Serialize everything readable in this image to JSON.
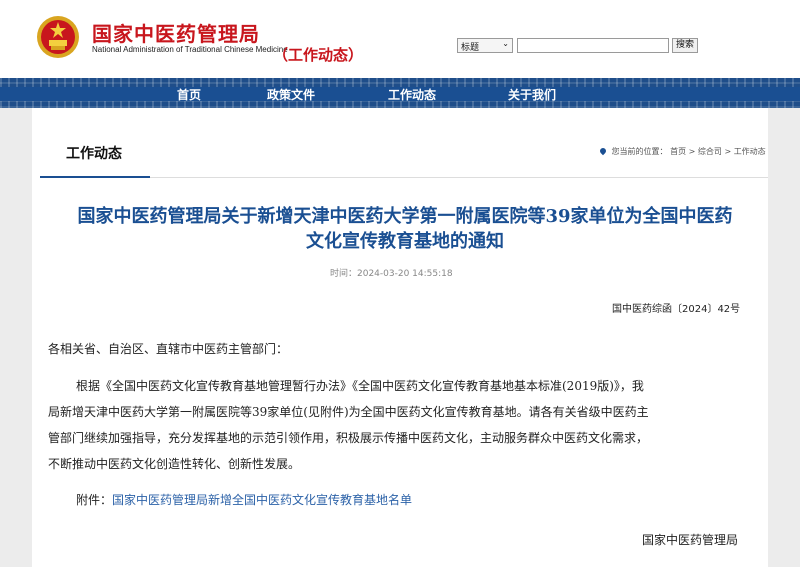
{
  "header": {
    "site_title_cn": "国家中医药管理局",
    "site_title_en": "National Administration of Traditional Chinese Medicine",
    "section_tag": "（工作动态）",
    "search": {
      "select_value": "标题",
      "button_label": "搜索",
      "input_value": ""
    }
  },
  "nav": {
    "items": [
      "首页",
      "政策文件",
      "工作动态",
      "关于我们"
    ]
  },
  "section": {
    "title": "工作动态"
  },
  "breadcrumb": {
    "prefix": "您当前的位置：",
    "items": [
      "首页",
      "综合司",
      "工作动态"
    ]
  },
  "article": {
    "title_line1": "国家中医药管理局关于新增天津中医药大学第一附属医院等39家单位为全国中医药",
    "title_line2": "文化宣传教育基地的通知",
    "time": "时间：2024-03-20 14:55:18",
    "doc_number": "国中医药综函〔2024〕42号",
    "salutation": "各相关省、自治区、直辖市中医药主管部门：",
    "body_lines": [
      "根据《全国中医药文化宣传教育基地管理暂行办法》《全国中医药文化宣传教育基地基本标准(2019版)》，我",
      "局新增天津中医药大学第一附属医院等39家单位(见附件)为全国中医药文化宣传教育基地。请各有关省级中医药主",
      "管部门继续加强指导，充分发挥基地的示范引领作用，积极展示传播中医药文化，主动服务群众中医药文化需求，",
      "不断推动中医药文化创造性转化、创新性发展。"
    ],
    "attachment_label": "附件：",
    "attachment_link": "国家中医药管理局新增全国中医药文化宣传教育基地名单",
    "signature": "国家中医药管理局"
  },
  "colors": {
    "brand_red": "#c8161d",
    "nav_blue": "#1a4f92",
    "link_blue": "#2c62a8"
  }
}
